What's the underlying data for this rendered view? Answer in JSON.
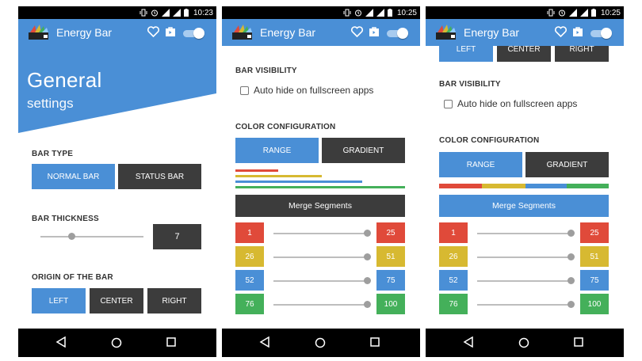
{
  "status": {
    "time": "10:23",
    "time2": "10:25",
    "time3": "10:25"
  },
  "app": {
    "title": "Energy Bar"
  },
  "icons": {
    "heart": "heart-icon",
    "bag": "shop-bag-icon",
    "toggle": "toggle-switch-icon"
  },
  "colors": {
    "blue": "#4a8fd6",
    "dark": "#3c3c3c",
    "red": "#e04a3a",
    "yellow": "#d7b931",
    "green": "#44b05a"
  },
  "screen1": {
    "hero_title": "General",
    "hero_subtitle": "settings",
    "bar_type_label": "BAR TYPE",
    "bar_type_options": [
      "NORMAL BAR",
      "STATUS BAR"
    ],
    "bar_type_selected": "NORMAL BAR",
    "thickness_label": "BAR THICKNESS",
    "thickness_value": "7",
    "origin_label": "ORIGIN OF THE BAR",
    "origin_options": [
      "LEFT",
      "CENTER",
      "RIGHT"
    ],
    "origin_selected": "LEFT"
  },
  "screen2": {
    "visibility_label": "BAR VISIBILITY",
    "auto_hide_label": "Auto hide on fullscreen apps",
    "auto_hide_checked": false,
    "color_config_label": "COLOR CONFIGURATION",
    "mode_options": [
      "RANGE",
      "GRADIENT"
    ],
    "mode_selected": "RANGE",
    "merge_label": "Merge Segments",
    "segments": [
      {
        "start": "1",
        "end": "25",
        "color": "red"
      },
      {
        "start": "26",
        "end": "51",
        "color": "yellow"
      },
      {
        "start": "52",
        "end": "75",
        "color": "blue"
      },
      {
        "start": "76",
        "end": "100",
        "color": "green"
      }
    ]
  },
  "screen3": {
    "top_partial_options": [
      "LEFT",
      "CENTER",
      "RIGHT"
    ],
    "visibility_label": "BAR VISIBILITY",
    "auto_hide_label": "Auto hide on fullscreen apps",
    "color_config_label": "COLOR CONFIGURATION",
    "mode_options": [
      "RANGE",
      "GRADIENT"
    ],
    "merge_label": "Merge Segments",
    "segments": [
      {
        "start": "1",
        "end": "25"
      },
      {
        "start": "26",
        "end": "51"
      },
      {
        "start": "52",
        "end": "75"
      },
      {
        "start": "76",
        "end": "100"
      }
    ]
  }
}
